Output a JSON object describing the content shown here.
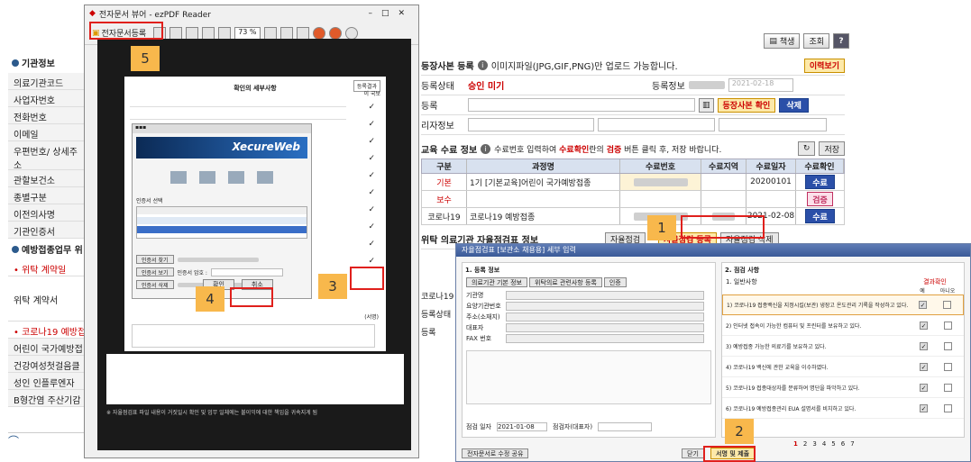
{
  "top_buttons": {
    "print": "책생",
    "lookup": "조회",
    "help": "?"
  },
  "left_panel": {
    "sec1": "기관정보",
    "rows": [
      "의료기관코드",
      "사업자번호",
      "전화번호",
      "이메일",
      "우편번호/ 상세주소",
      "관할보건소",
      "종별구분",
      "이전의사명",
      "기관인증서"
    ],
    "sec2": "예방접종업무 위",
    "contract_hdr": "위탁 계약일",
    "contract_row": "위탁 계약서",
    "covid_hdr": "코로나19 예방접",
    "lower_rows": [
      "어린이 국가예방접",
      "건강여성첫걸음클",
      "성인 인플루엔자 ",
      "B형간염 주산기감"
    ]
  },
  "main": {
    "reg_title": "등장사본 등록",
    "reg_note": "이미지파일(JPG,GIF,PNG)만 업로드 가능합니다.",
    "history_btn": "이력보기",
    "status_label": "등록상태",
    "status_value": "승인 미기",
    "reg_info": "등록정보",
    "date1": "2021-02-18",
    "file_label": "등록",
    "confirm_btn": "등장사본 확인",
    "delete_btn": "삭제",
    "extra_label": "리자정보",
    "edu_title": "교육 수료 정보",
    "edu_note_pre": "수료번호 입력하여 ",
    "edu_note_red1": "수료확인",
    "edu_note_mid": "란의 ",
    "edu_note_red2": "검증",
    "edu_note_post": " 버튼 클릭 후, 저장 바랍니다.",
    "save_btn": "저장",
    "cols": [
      "구분",
      "과정명",
      "수료번호",
      "수료지역",
      "수료일자",
      "수료확인"
    ],
    "rows": [
      {
        "type": "기본",
        "name": "1기 [기본교육]어린이 국가예방접종",
        "date": "20200101",
        "btn": "수료"
      },
      {
        "type": "보수",
        "name": "",
        "date": "",
        "btn": "검증"
      },
      {
        "type": "코로나19",
        "name": "코로나19 예방접종",
        "date": "2021-02-08",
        "btn": "수료"
      }
    ],
    "self_title": "위탁 의료기관 자율점검표 정보",
    "self_btn1": "자율점검",
    "self_btn2": "자율점검 등록",
    "self_btn3": "자율점검 삭제",
    "lower": [
      "코로나19",
      "등록상태",
      "등록"
    ]
  },
  "viewer": {
    "title": "전자문서 뷰어 - ezPDF Reader",
    "register_btn": "전자문서등록",
    "zoom": "73 %",
    "page_title": "확인의 세부사항",
    "check_hdr": "등록결과",
    "check_col": "이 국보",
    "xecure": "XecureWeb",
    "cert_title": "인증서 선택",
    "cert_btn1": "인증서 찾기",
    "cert_btn2": "인증서 보기",
    "cert_btn3": "인증서 삭제",
    "pw_label": "인증서 암호 :",
    "ok_btn": "확인",
    "cancel_btn": "취소",
    "sig_label": "(서명)",
    "bottom_note": "※ 자율점검표 파일 내용이 거짓일시 확인 및 업무 일체에는 불이익에 대한 책임을 귀속지게 됨"
  },
  "dialog": {
    "title": "자율점검표 [보관소 채용용] 세부 입력",
    "sec_a": "1. 등록 정보",
    "tabs": [
      "의료기관 기본 정보",
      "위탁의료 관련사항 등록",
      "인증"
    ],
    "fields": [
      "기관명",
      "요양기관번호",
      "주소(소재지)",
      "대표자",
      "FAX 번호"
    ],
    "sec_b": "2. 점검 사항",
    "sub_b": "1. 일반사항",
    "col_hdr": "결과확인",
    "col_yes": "예",
    "col_no": "아니오",
    "items": [
      "1) 코로나19 접종백신을 지정시킬(보관) 냉장고 온도관리 기록을 작성하고 있다.",
      "2) 인터넷 접속이 가능한 컴퓨터 및 프린터를 보유하고 있다.",
      "3) 예방접종 가능한 의료기를 보유하고 있다.",
      "4) 코로나19 백신에 관한 교육을 이수하였다.",
      "5) 코로나19 접종대상자를 분류하여 명단을 파악하고 있다.",
      "6) 코로나19 예방접종관리 EUA 설명서를 비치하고 있다."
    ],
    "date_label": "점검 일자",
    "date_val": "2021-01-08",
    "inspector": "점검자(대표자)",
    "pager": [
      "1",
      "2",
      "3",
      "4",
      "5",
      "6",
      "7"
    ],
    "bottom_left": "전자문서로 수정 공유",
    "btn_close": "닫기",
    "btn_submit": "서명 및 제출"
  },
  "markers": [
    "1",
    "2",
    "3",
    "4",
    "5"
  ]
}
